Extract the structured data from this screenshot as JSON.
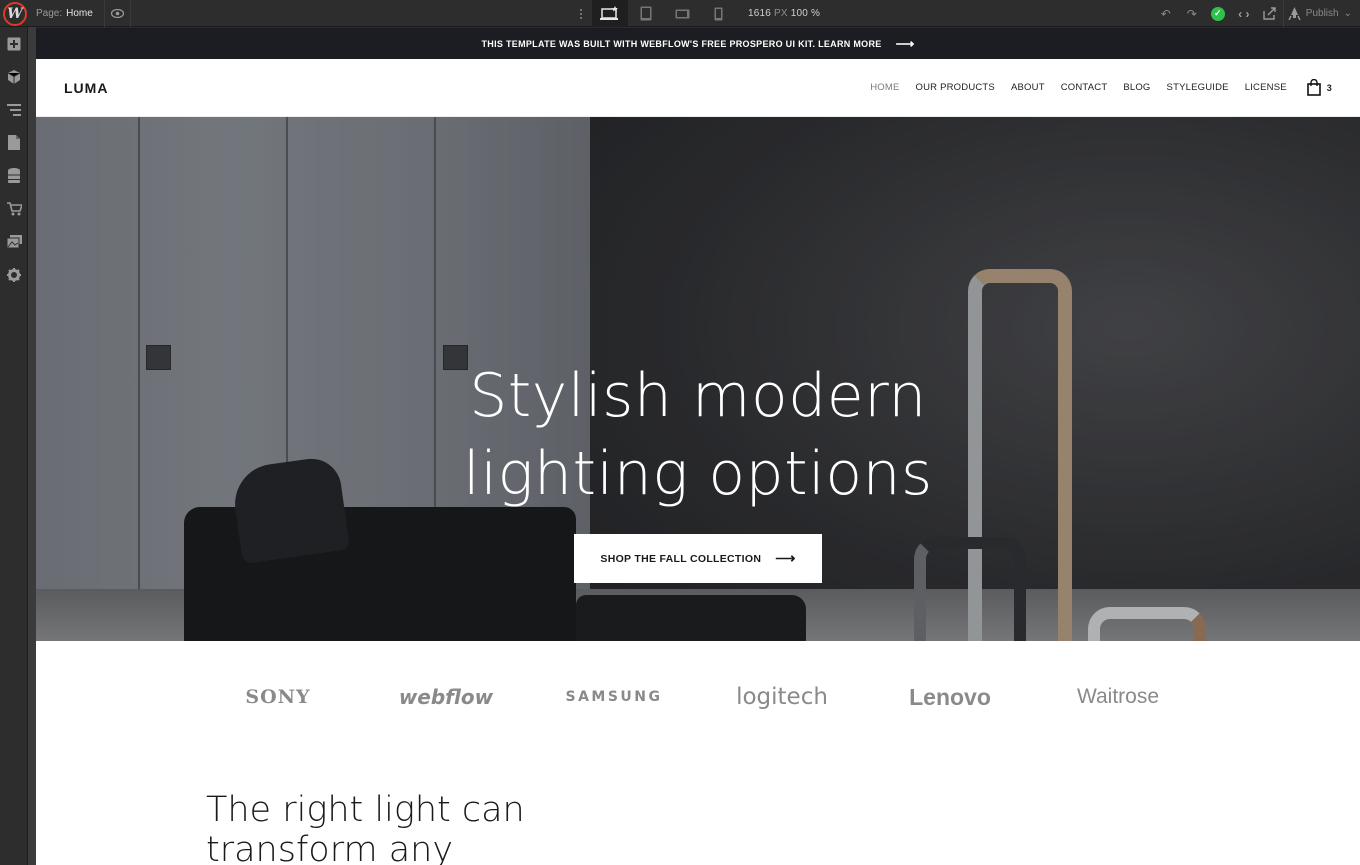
{
  "designer": {
    "page_prefix": "Page:",
    "page_name": "Home",
    "width_value": "1616",
    "width_unit": "PX",
    "zoom": "100 %",
    "publish_label": "Publish",
    "icons": {
      "logo": "webflow-logo-icon",
      "preview": "eye-icon",
      "more": "kebab-icon",
      "devices": [
        "desktop-icon",
        "tablet-icon",
        "mobile-landscape-icon",
        "mobile-portrait-icon"
      ],
      "undo": "undo-icon",
      "redo": "redo-icon",
      "status": "check-icon",
      "code": "code-icon",
      "export": "export-icon",
      "publish": "rocket-icon"
    },
    "sidebar_icons": [
      "add-icon",
      "symbols-icon",
      "navigator-icon",
      "pages-icon",
      "cms-icon",
      "ecommerce-icon",
      "assets-icon",
      "settings-icon"
    ],
    "colors": {
      "chrome": "#2d2d2d",
      "active_status": "#2ec24a",
      "logo_ring": "#e0392b"
    }
  },
  "site": {
    "banner_text": "THIS TEMPLATE WAS BUILT WITH WEBFLOW'S FREE PROSPERO UI KIT. LEARN MORE",
    "banner_arrow": "⟶",
    "brand": "LUMA",
    "nav": [
      "HOME",
      "OUR PRODUCTS",
      "ABOUT",
      "CONTACT",
      "BLOG",
      "STYLEGUIDE",
      "LICENSE"
    ],
    "cart_count": "3",
    "hero": {
      "title_line1": "Stylish modern",
      "title_line2": "lighting options",
      "cta_label": "SHOP THE FALL COLLECTION",
      "cta_arrow": "⟶"
    },
    "logos": [
      "SONY",
      "webflow",
      "SAMSUNG",
      "logitech",
      "Lenovo",
      "Waitrose"
    ],
    "intro_line1": "The right light can",
    "intro_line2": "transform any"
  }
}
